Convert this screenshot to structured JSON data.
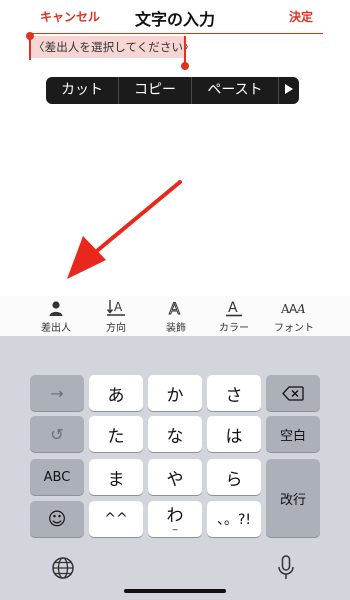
{
  "nav": {
    "cancel": "キャンセル",
    "title": "文字の入力",
    "done": "決定"
  },
  "editor": {
    "selected_text": "〈差出人を選択してください〉"
  },
  "edit_menu": {
    "items": [
      "カット",
      "コピー",
      "ペースト"
    ],
    "more_icon": "triangle-right-icon"
  },
  "style_toolbar": {
    "items": [
      {
        "label": "差出人",
        "icon": "person-icon"
      },
      {
        "label": "方向",
        "icon": "text-direction-icon"
      },
      {
        "label": "装飾",
        "icon": "text-outline-icon"
      },
      {
        "label": "カラー",
        "icon": "text-color-icon"
      },
      {
        "label": "フォント",
        "icon": "font-icon"
      }
    ]
  },
  "keyboard": {
    "rows": [
      [
        "→",
        "あ",
        "か",
        "さ",
        "⌫"
      ],
      [
        "↺",
        "た",
        "な",
        "は",
        "空白"
      ],
      [
        "ABC",
        "ま",
        "や",
        "ら",
        "改行"
      ],
      [
        "☺",
        "^^",
        "わ",
        "、。?!"
      ]
    ],
    "wa_sub": "_",
    "icons": {
      "globe": "globe-icon",
      "mic": "microphone-icon"
    }
  },
  "colors": {
    "accent": "#e0321f",
    "keyboard_bg": "#d2d5db",
    "key_light": "#ffffff",
    "key_dark": "#acb1b9"
  }
}
